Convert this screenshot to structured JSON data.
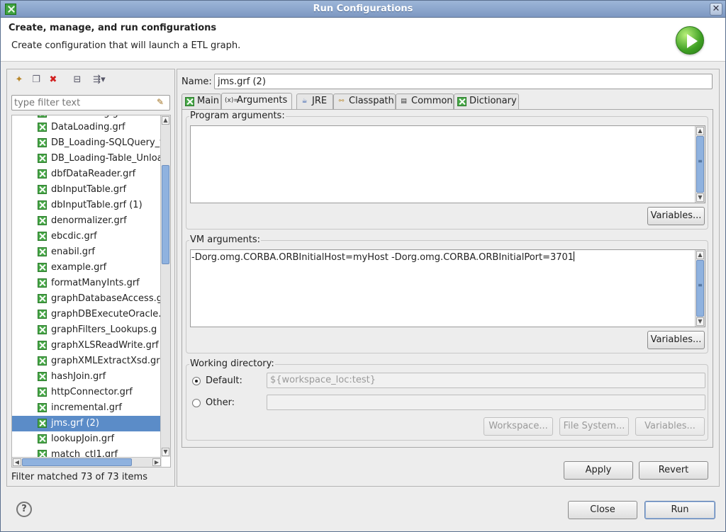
{
  "window": {
    "title": "Run Configurations"
  },
  "header": {
    "title": "Create, manage, and run configurations",
    "subtitle": "Create configuration that will launch a ETL graph."
  },
  "left": {
    "filter_placeholder": "type filter text",
    "items": [
      {
        "label": "DataLoading.grf"
      },
      {
        "label": "DB_Loading-SQLQuery_f"
      },
      {
        "label": "DB_Loading-Table_Unloa"
      },
      {
        "label": "dbfDataReader.grf"
      },
      {
        "label": "dbInputTable.grf"
      },
      {
        "label": "dbInputTable.grf (1)"
      },
      {
        "label": "denormalizer.grf"
      },
      {
        "label": "ebcdic.grf"
      },
      {
        "label": "enabil.grf"
      },
      {
        "label": "example.grf"
      },
      {
        "label": "formatManyInts.grf"
      },
      {
        "label": "graphDatabaseAccess.g"
      },
      {
        "label": "graphDBExecuteOracle."
      },
      {
        "label": "graphFilters_Lookups.g"
      },
      {
        "label": "graphXLSReadWrite.grf"
      },
      {
        "label": "graphXMLExtractXsd.gr"
      },
      {
        "label": "hashJoin.grf"
      },
      {
        "label": "httpConnector.grf"
      },
      {
        "label": "incremental.grf"
      },
      {
        "label": "jms.grf (2)"
      },
      {
        "label": "lookupJoin.grf"
      },
      {
        "label": "match_ctl1.grf"
      }
    ],
    "status": "Filter matched 73 of 73 items"
  },
  "right": {
    "name_label": "Name:",
    "name_value": "jms.grf (2)",
    "tabs": [
      "Main",
      "Arguments",
      "JRE",
      "Classpath",
      "Common",
      "Dictionary"
    ],
    "program_args": {
      "label": "Program arguments:",
      "value": "",
      "variables_button": "Variables..."
    },
    "vm_args": {
      "label": "VM arguments:",
      "value": "-Dorg.omg.CORBA.ORBInitialHost=myHost -Dorg.omg.CORBA.ORBInitialPort=3701",
      "variables_button": "Variables..."
    },
    "working_dir": {
      "label": "Working directory:",
      "default_label": "Default:",
      "default_value": "${workspace_loc:test}",
      "other_label": "Other:",
      "other_value": "",
      "workspace_button": "Workspace...",
      "filesystem_button": "File System...",
      "variables_button": "Variables..."
    },
    "apply_button": "Apply",
    "revert_button": "Revert"
  },
  "footer": {
    "close_button": "Close",
    "run_button": "Run"
  }
}
